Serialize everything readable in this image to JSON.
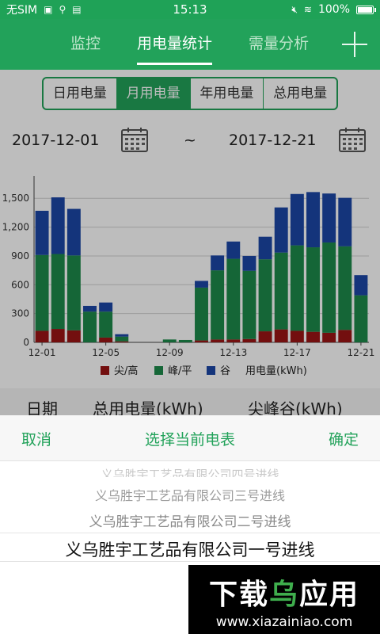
{
  "status_bar": {
    "carrier": "无SIM",
    "time": "15:13",
    "battery": "100%"
  },
  "tabs": [
    {
      "label": "监控"
    },
    {
      "label": "用电量统计"
    },
    {
      "label": "需量分析"
    }
  ],
  "period_options": [
    {
      "label": "日用电量"
    },
    {
      "label": "月用电量"
    },
    {
      "label": "年用电量"
    },
    {
      "label": "总用电量"
    }
  ],
  "date_range": {
    "start": "2017-12-01",
    "separator": "~",
    "end": "2017-12-21"
  },
  "chart_data": {
    "type": "bar",
    "stacked": true,
    "x_labels": [
      "12-01",
      "12-05",
      "12-09",
      "12-13",
      "12-17",
      "12-21"
    ],
    "x_label_days": [
      1,
      5,
      9,
      13,
      17,
      21
    ],
    "days": [
      1,
      2,
      3,
      4,
      5,
      6,
      7,
      8,
      9,
      10,
      11,
      12,
      13,
      14,
      15,
      16,
      17,
      18,
      19,
      20,
      21
    ],
    "ylim": [
      0,
      1700
    ],
    "yticks": [
      0,
      300,
      600,
      900,
      1200,
      1500
    ],
    "ytick_labels": [
      "0",
      "300",
      "600",
      "900",
      "1,200",
      "1,500"
    ],
    "series": [
      {
        "name": "尖/高",
        "color": "#9b1515",
        "values": [
          120,
          140,
          125,
          0,
          50,
          10,
          0,
          0,
          0,
          0,
          20,
          30,
          30,
          35,
          115,
          135,
          120,
          110,
          100,
          130,
          0
        ]
      },
      {
        "name": "峰/平",
        "color": "#1d8a4b",
        "values": [
          790,
          780,
          780,
          320,
          270,
          50,
          0,
          0,
          30,
          25,
          550,
          720,
          840,
          710,
          750,
          800,
          890,
          880,
          940,
          870,
          490
        ]
      },
      {
        "name": "谷",
        "color": "#1c47a6",
        "values": [
          460,
          590,
          485,
          60,
          95,
          25,
          0,
          0,
          0,
          0,
          70,
          155,
          180,
          155,
          235,
          470,
          535,
          575,
          510,
          505,
          210
        ]
      }
    ],
    "legend_extra": "用电量(kWh)",
    "grid": "horizontal",
    "legend_position": "bottom"
  },
  "table_header": {
    "date": "日期",
    "total": "总用电量(kWh)",
    "peak_valley": "尖峰谷(kWh)"
  },
  "picker_sheet": {
    "cancel": "取消",
    "title": "选择当前电表",
    "confirm": "确定",
    "items": [
      "义乌胜宇工艺品有限公司一号进线",
      "义乌胜宇工艺品有限公司二号进线",
      "义乌胜宇工艺品有限公司三号进线",
      "义乌胜宇工艺品有限公司四号进线"
    ]
  },
  "watermark": {
    "brand_part1": "下载",
    "brand_part2": "乌",
    "brand_part3": "应用",
    "url": "www.xiazainiao.com"
  },
  "colors": {
    "primary": "#22a25a",
    "status_bar": "#1fa257"
  }
}
